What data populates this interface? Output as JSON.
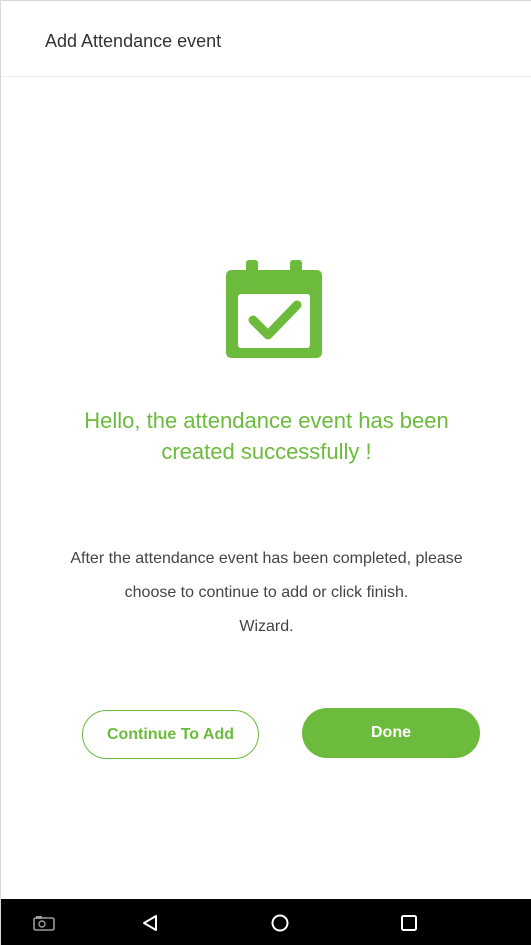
{
  "header": {
    "title": "Add Attendance event"
  },
  "success": {
    "icon": "calendar-check-icon",
    "message_line1": "Hello, the attendance event has been",
    "message_line2": "created successfully !"
  },
  "instructions": {
    "line1": "After the attendance event has been completed, please",
    "line2": "choose to continue to add or click finish.",
    "line3": "Wizard."
  },
  "buttons": {
    "continue_label": "Continue To Add",
    "done_label": "Done"
  },
  "navbar": {
    "items": [
      "screenshot-icon",
      "back-icon",
      "home-icon",
      "recents-icon"
    ]
  },
  "colors": {
    "accent": "#6cbb3c",
    "text": "#444444",
    "navbar": "#000000"
  }
}
